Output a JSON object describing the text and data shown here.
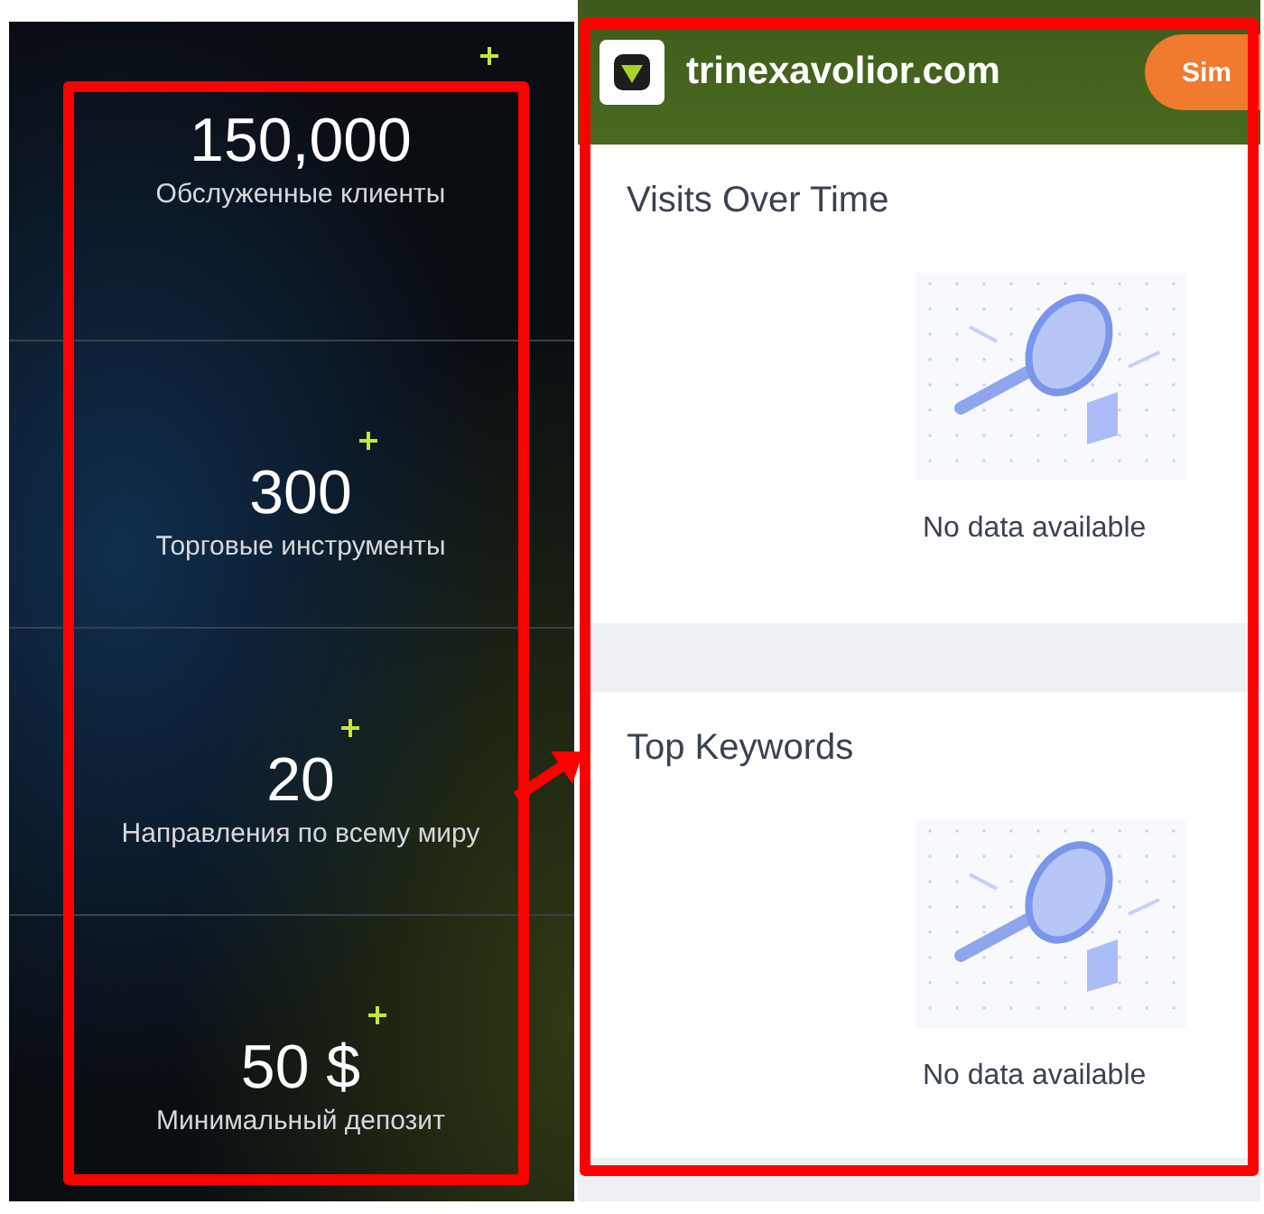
{
  "stats_panel": {
    "stats": [
      {
        "value": "150,000",
        "label": "Обслуженные клиенты"
      },
      {
        "value": "300",
        "label": "Торговые инструменты"
      },
      {
        "value": "20",
        "label": "Направления по всему миру"
      },
      {
        "value": "50 $",
        "label": "Минимальный депозит"
      }
    ]
  },
  "site_panel": {
    "header": {
      "domain": "trinexavolior.com",
      "button": "Sim"
    },
    "cards": [
      {
        "title": "Visits Over Time",
        "empty_message": "No data available"
      },
      {
        "title": "Top Keywords",
        "empty_message": "No data available"
      }
    ]
  }
}
